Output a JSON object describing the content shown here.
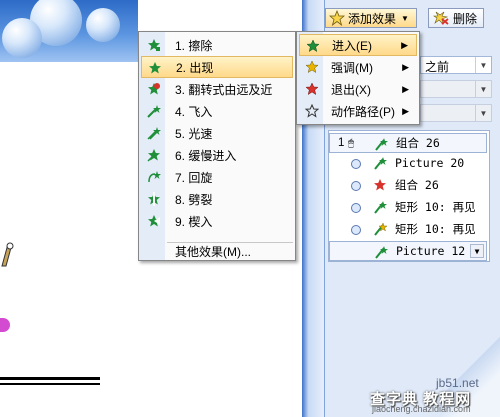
{
  "toolbar": {
    "add_effect_label": "添加效果",
    "delete_label": "删除"
  },
  "pane": {
    "start_value": "之前"
  },
  "main_menu": {
    "items": [
      {
        "label": "1. 擦除",
        "icon": "green-star-effect-icon",
        "highlighted": false
      },
      {
        "label": "2. 出现",
        "icon": "green-star-effect-icon",
        "highlighted": true
      },
      {
        "label": "3. 翻转式由远及近",
        "icon": "red-star-effect-icon",
        "highlighted": false
      },
      {
        "label": "4. 飞入",
        "icon": "green-star-effect-icon",
        "highlighted": false
      },
      {
        "label": "5. 光速",
        "icon": "green-star-effect-icon",
        "highlighted": false
      },
      {
        "label": "6. 缓慢进入",
        "icon": "green-star-effect-icon",
        "highlighted": false
      },
      {
        "label": "7. 回旋",
        "icon": "green-star-effect-icon",
        "highlighted": false
      },
      {
        "label": "8. 劈裂",
        "icon": "green-star-effect-icon",
        "highlighted": false
      },
      {
        "label": "9. 楔入",
        "icon": "green-star-effect-icon",
        "highlighted": false
      }
    ],
    "other_label": "其他效果(M)..."
  },
  "sub_menu": {
    "items": [
      {
        "label": "进入(E)",
        "icon": "green-star-icon",
        "highlighted": true
      },
      {
        "label": "强调(M)",
        "icon": "yellow-star-icon",
        "highlighted": false
      },
      {
        "label": "退出(X)",
        "icon": "red-star-icon",
        "highlighted": false
      },
      {
        "label": "动作路径(P)",
        "icon": "outline-star-icon",
        "highlighted": false
      }
    ]
  },
  "sequence": {
    "rows": [
      {
        "num": "1",
        "text": "组合 26",
        "icon": "green-star-icon"
      },
      {
        "num": "",
        "text": "Picture 20",
        "icon": "green-star-icon"
      },
      {
        "num": "",
        "text": "组合 26",
        "icon": "red-star-icon"
      },
      {
        "num": "",
        "text": "矩形 10: 再见",
        "icon": "green-star-icon"
      },
      {
        "num": "",
        "text": "矩形 10: 再见",
        "icon": "yellow-star-icon"
      },
      {
        "num": "",
        "text": "Picture 12",
        "icon": "green-star-icon"
      }
    ]
  },
  "watermark": {
    "site": "jb51.net",
    "brand": "查字典 教程网",
    "url": "jiaocheng.chazidian.com"
  },
  "colors": {
    "highlight_top": "#fff3c8",
    "highlight_bottom": "#ffd98a",
    "pane_bg": "#dfe9f8",
    "star_green": "#1f8f3a",
    "star_red": "#d8322b",
    "star_yellow": "#e8b400"
  }
}
